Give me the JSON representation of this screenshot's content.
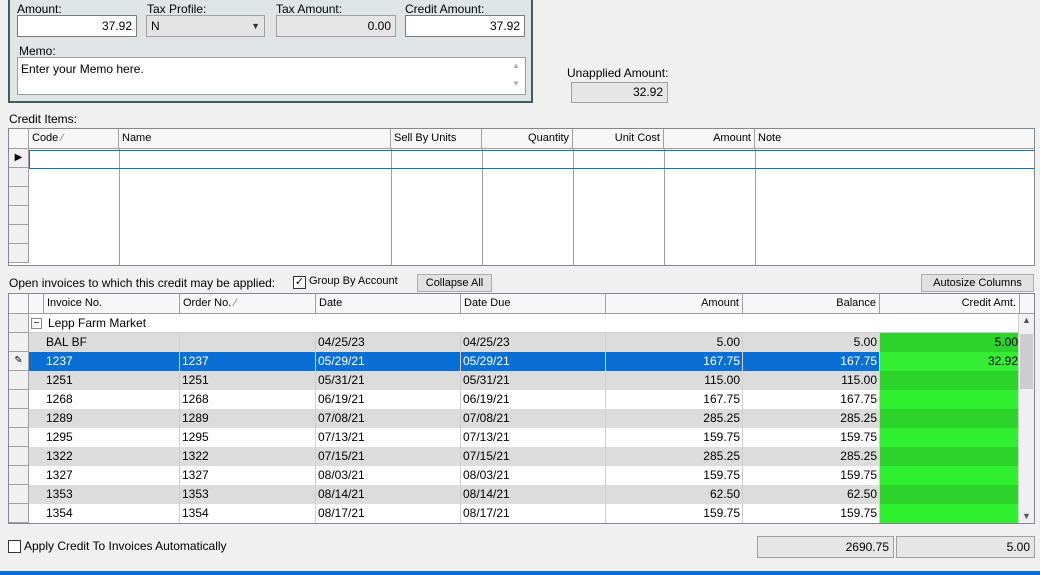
{
  "form": {
    "amount_label": "Amount:",
    "amount_value": "37.92",
    "tax_profile_label": "Tax Profile:",
    "tax_profile_value": "N",
    "tax_amount_label": "Tax Amount:",
    "tax_amount_value": "0.00",
    "credit_amount_label": "Credit Amount:",
    "credit_amount_value": "37.92",
    "memo_label": "Memo:",
    "memo_value": "Enter your Memo here.",
    "unapplied_label": "Unapplied Amount:",
    "unapplied_value": "32.92"
  },
  "credit_items": {
    "label": "Credit Items:",
    "columns": [
      "Code",
      "Name",
      "Sell By Units",
      "Quantity",
      "Unit Cost",
      "Amount",
      "Note"
    ],
    "sort_indicator": "⁄"
  },
  "invoices_toolbar": {
    "label": "Open invoices to which this credit may be applied:",
    "group_by_label": "Group By Account",
    "group_by_checked": true,
    "collapse_all": "Collapse All",
    "autosize": "Autosize Columns"
  },
  "invoices": {
    "columns": [
      "Invoice No.",
      "Order No.",
      "Date",
      "Date Due",
      "Amount",
      "Balance",
      "Credit Amt."
    ],
    "sort_indicator": "⁄",
    "group_name": "Lepp Farm Market",
    "group_toggle": "−",
    "rows": [
      {
        "invoice": "BAL BF",
        "order": "",
        "date": "04/25/23",
        "due": "04/25/23",
        "amount": "5.00",
        "balance": "5.00",
        "credit": "5.00",
        "style": "gray"
      },
      {
        "invoice": "1237",
        "order": "1237",
        "date": "05/29/21",
        "due": "05/29/21",
        "amount": "167.75",
        "balance": "167.75",
        "credit": "32.92",
        "style": "sel"
      },
      {
        "invoice": "1251",
        "order": "1251",
        "date": "05/31/21",
        "due": "05/31/21",
        "amount": "115.00",
        "balance": "115.00",
        "credit": "",
        "style": "gray"
      },
      {
        "invoice": "1268",
        "order": "1268",
        "date": "06/19/21",
        "due": "06/19/21",
        "amount": "167.75",
        "balance": "167.75",
        "credit": "",
        "style": "white"
      },
      {
        "invoice": "1289",
        "order": "1289",
        "date": "07/08/21",
        "due": "07/08/21",
        "amount": "285.25",
        "balance": "285.25",
        "credit": "",
        "style": "gray"
      },
      {
        "invoice": "1295",
        "order": "1295",
        "date": "07/13/21",
        "due": "07/13/21",
        "amount": "159.75",
        "balance": "159.75",
        "credit": "",
        "style": "white"
      },
      {
        "invoice": "1322",
        "order": "1322",
        "date": "07/15/21",
        "due": "07/15/21",
        "amount": "285.25",
        "balance": "285.25",
        "credit": "",
        "style": "gray"
      },
      {
        "invoice": "1327",
        "order": "1327",
        "date": "08/03/21",
        "due": "08/03/21",
        "amount": "159.75",
        "balance": "159.75",
        "credit": "",
        "style": "white"
      },
      {
        "invoice": "1353",
        "order": "1353",
        "date": "08/14/21",
        "due": "08/14/21",
        "amount": "62.50",
        "balance": "62.50",
        "credit": "",
        "style": "gray"
      },
      {
        "invoice": "1354",
        "order": "1354",
        "date": "08/17/21",
        "due": "08/17/21",
        "amount": "159.75",
        "balance": "159.75",
        "credit": "",
        "style": "white"
      }
    ]
  },
  "footer": {
    "apply_auto_label": "Apply Credit To Invoices Automatically",
    "apply_auto_checked": false,
    "total_balance": "2690.75",
    "total_credit": "5.00"
  },
  "colors": {
    "selection": "#0a6fd4",
    "credit_green": "#2ff02f",
    "group_border": "#3d5f5f"
  }
}
